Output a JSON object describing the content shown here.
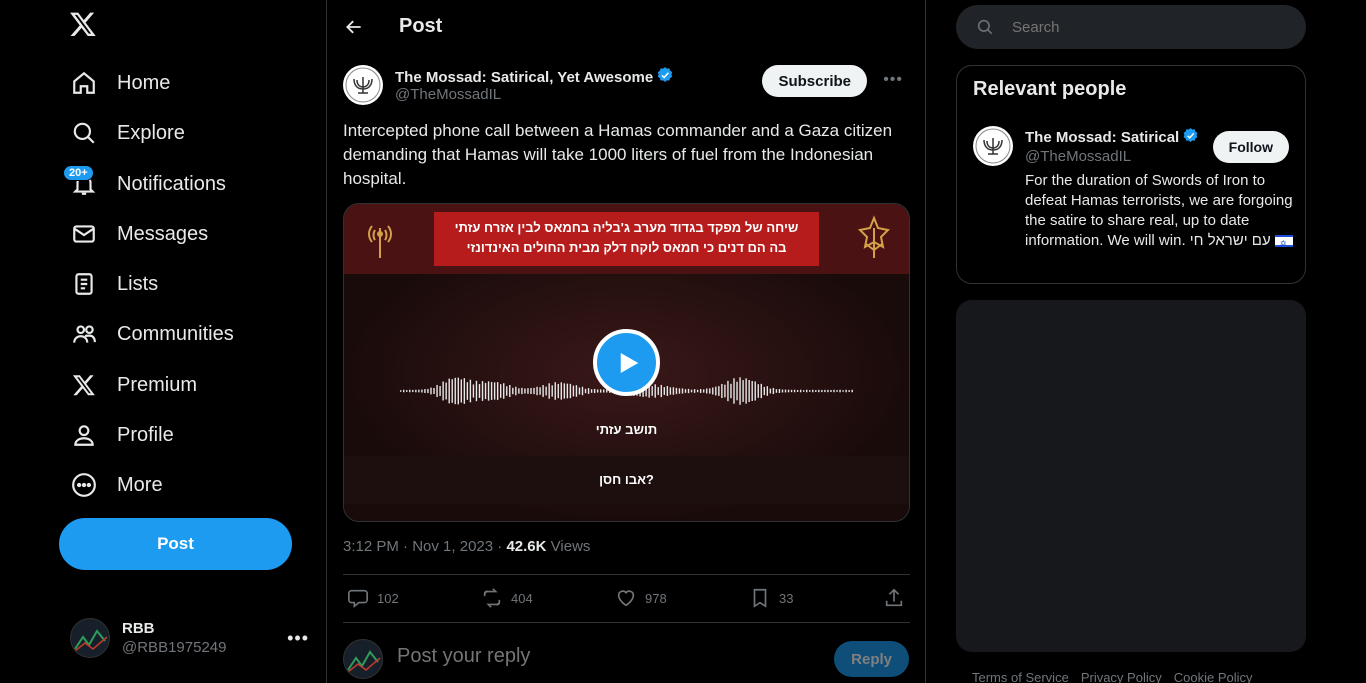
{
  "nav": {
    "logo": "x-logo-icon",
    "items": [
      {
        "label": "Home",
        "icon": "home-icon"
      },
      {
        "label": "Explore",
        "icon": "search-icon"
      },
      {
        "label": "Notifications",
        "icon": "bell-icon",
        "badge": "20+"
      },
      {
        "label": "Messages",
        "icon": "envelope-icon"
      },
      {
        "label": "Lists",
        "icon": "list-icon"
      },
      {
        "label": "Communities",
        "icon": "communities-icon"
      },
      {
        "label": "Premium",
        "icon": "x-logo-icon"
      },
      {
        "label": "Profile",
        "icon": "person-icon"
      },
      {
        "label": "More",
        "icon": "more-circle-icon"
      }
    ],
    "post_button": "Post",
    "account": {
      "name": "RBB",
      "handle": "@RBB1975249"
    }
  },
  "main": {
    "title": "Post",
    "author": {
      "name": "The Mossad: Satirical, Yet Awesome",
      "handle": "@TheMossadIL",
      "verified": true
    },
    "subscribe_label": "Subscribe",
    "tweet_text": "Intercepted phone call between a Hamas commander and a Gaza citizen demanding that Hamas will take 1000 liters of fuel from the Indonesian hospital.",
    "media": {
      "banner_line1": "שיחה של מפקד בגדוד מערב ג'בליה בחמאס לבין אזרח עזתי",
      "banner_line2": "בה הם דנים כי חמאס לוקח דלק מבית החולים האינדונזי",
      "speaker1": "תושב עזתי",
      "speaker2": "?אבו חסן"
    },
    "meta": {
      "time": "3:12 PM",
      "date": "Nov 1, 2023",
      "views_count": "42.6K",
      "views_label": "Views"
    },
    "stats": {
      "replies": "102",
      "reposts": "404",
      "likes": "978",
      "bookmarks": "33"
    },
    "reply": {
      "placeholder": "Post your reply",
      "button": "Reply"
    }
  },
  "right": {
    "search_placeholder": "Search",
    "relevant": {
      "title": "Relevant people",
      "name": "The Mossad: Satirical",
      "handle": "@TheMossadIL",
      "follow_label": "Follow",
      "bio": "For the duration of Swords of Iron to defeat Hamas terrorists, we are forgoing the satire to share real, up to date information. We will win. עם ישראל חי"
    },
    "footer": [
      "Terms of Service",
      "Privacy Policy",
      "Cookie Policy"
    ]
  },
  "colors": {
    "accent": "#1d9bf0",
    "background": "#000000",
    "text": "#e7e9ea",
    "muted": "#71767b",
    "border": "#2f3336"
  }
}
